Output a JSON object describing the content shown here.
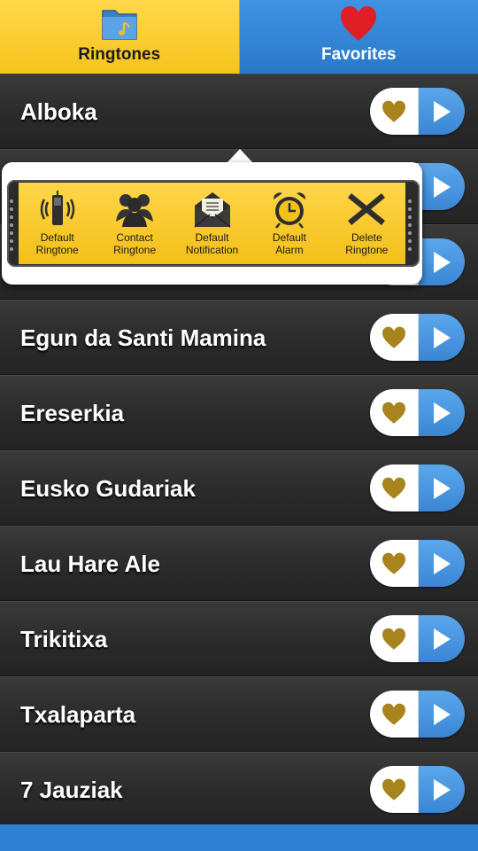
{
  "tabs": [
    {
      "label": "Ringtones",
      "active": true,
      "icon": "folder-music-icon"
    },
    {
      "label": "Favorites",
      "active": false,
      "icon": "heart-icon"
    }
  ],
  "ringtones": [
    {
      "title": "Alboka"
    },
    {
      "title": ""
    },
    {
      "title": ""
    },
    {
      "title": "Egun da Santi Mamina"
    },
    {
      "title": "Ereserkia"
    },
    {
      "title": "Eusko Gudariak"
    },
    {
      "title": "Lau Hare Ale"
    },
    {
      "title": "Trikitixa"
    },
    {
      "title": "Txalaparta"
    },
    {
      "title": "7 Jauziak"
    }
  ],
  "popup": {
    "actions": [
      {
        "label": "Default\nRingtone",
        "icon": "phone-ringing-icon"
      },
      {
        "label": "Contact\nRingtone",
        "icon": "contacts-icon"
      },
      {
        "label": "Default\nNotification",
        "icon": "envelope-icon"
      },
      {
        "label": "Default\nAlarm",
        "icon": "alarm-clock-icon"
      },
      {
        "label": "Delete\nRingtone",
        "icon": "delete-x-icon"
      }
    ]
  },
  "colors": {
    "tab_active": "#f6c31c",
    "tab_inactive": "#2a78c9",
    "heart_gold": "#a8841e",
    "play_blue": "#3b86d4",
    "row_bg": "#2a2a2a"
  }
}
